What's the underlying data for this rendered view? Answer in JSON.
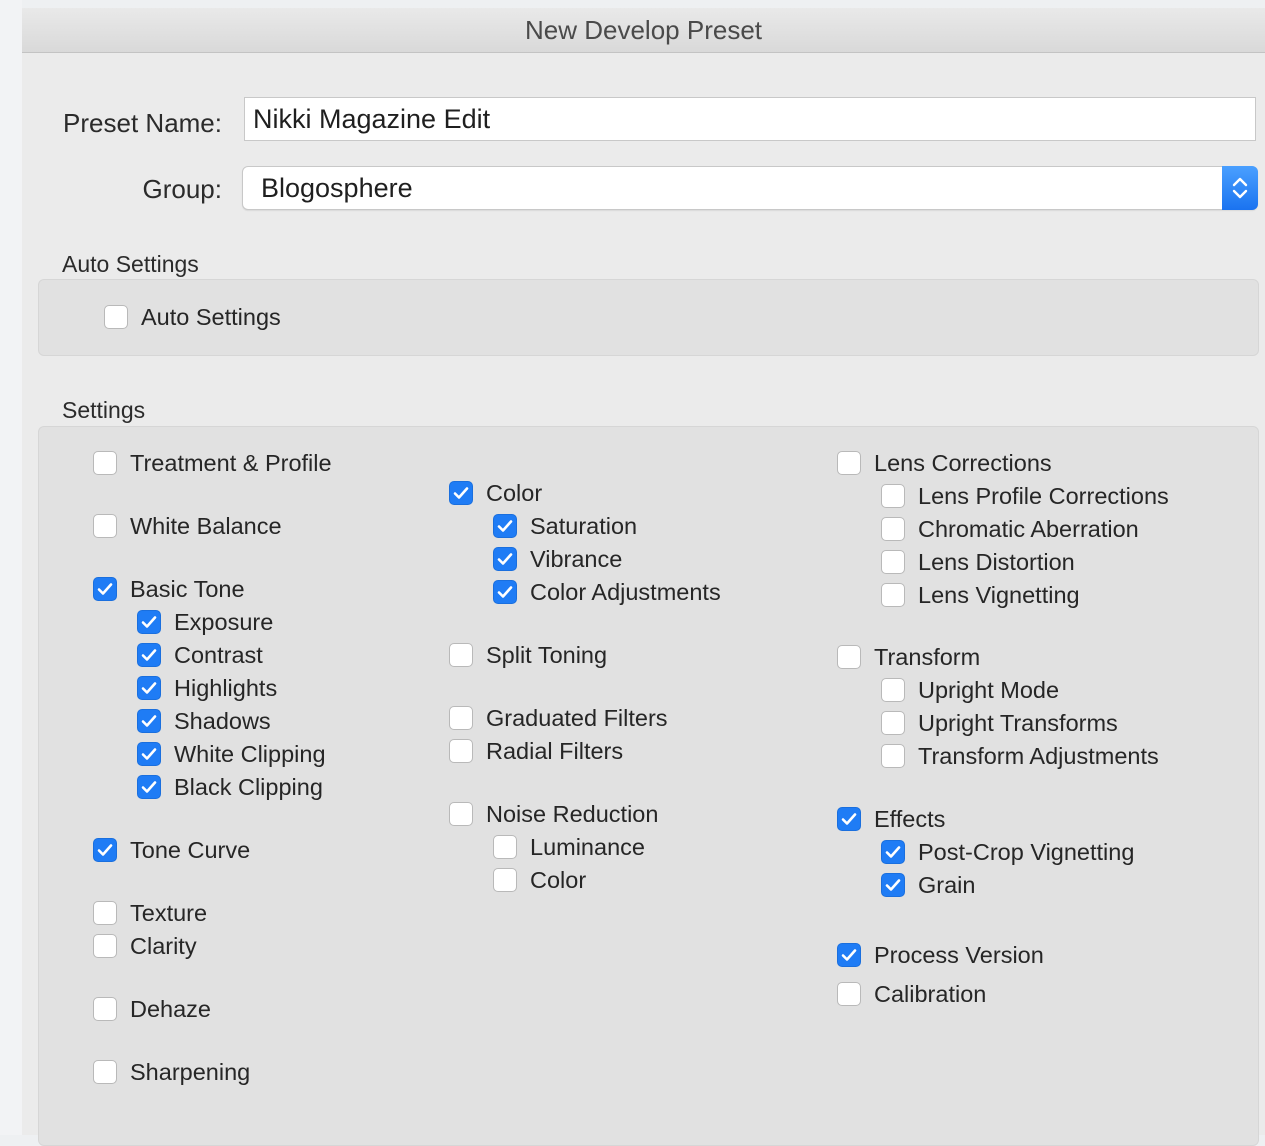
{
  "dialog": {
    "title": "New Develop Preset",
    "preset_name_label": "Preset Name:",
    "preset_name_value": "Nikki Magazine Edit",
    "group_label": "Group:",
    "group_value": "Blogosphere"
  },
  "auto_settings": {
    "section_title": "Auto Settings",
    "checkbox_label": "Auto Settings",
    "checked": false
  },
  "settings": {
    "section_title": "Settings",
    "col1": [
      {
        "label": "Treatment & Profile",
        "checked": false
      },
      {
        "label": "White Balance",
        "checked": false
      },
      {
        "label": "Basic Tone",
        "checked": true
      },
      {
        "label": "Exposure",
        "checked": true
      },
      {
        "label": "Contrast",
        "checked": true
      },
      {
        "label": "Highlights",
        "checked": true
      },
      {
        "label": "Shadows",
        "checked": true
      },
      {
        "label": "White Clipping",
        "checked": true
      },
      {
        "label": "Black Clipping",
        "checked": true
      },
      {
        "label": "Tone Curve",
        "checked": true
      },
      {
        "label": "Texture",
        "checked": false
      },
      {
        "label": "Clarity",
        "checked": false
      },
      {
        "label": "Dehaze",
        "checked": false
      },
      {
        "label": "Sharpening",
        "checked": false
      }
    ],
    "col2": [
      {
        "label": "Color",
        "checked": true
      },
      {
        "label": "Saturation",
        "checked": true
      },
      {
        "label": "Vibrance",
        "checked": true
      },
      {
        "label": "Color Adjustments",
        "checked": true
      },
      {
        "label": "Split Toning",
        "checked": false
      },
      {
        "label": "Graduated Filters",
        "checked": false
      },
      {
        "label": "Radial Filters",
        "checked": false
      },
      {
        "label": "Noise Reduction",
        "checked": false
      },
      {
        "label": "Luminance",
        "checked": false
      },
      {
        "label": "Color",
        "checked": false
      }
    ],
    "col3": [
      {
        "label": "Lens Corrections",
        "checked": false
      },
      {
        "label": "Lens Profile Corrections",
        "checked": false
      },
      {
        "label": "Chromatic Aberration",
        "checked": false
      },
      {
        "label": "Lens Distortion",
        "checked": false
      },
      {
        "label": "Lens Vignetting",
        "checked": false
      },
      {
        "label": "Transform",
        "checked": false
      },
      {
        "label": "Upright Mode",
        "checked": false
      },
      {
        "label": "Upright Transforms",
        "checked": false
      },
      {
        "label": "Transform Adjustments",
        "checked": false
      },
      {
        "label": "Effects",
        "checked": true
      },
      {
        "label": "Post-Crop Vignetting",
        "checked": true
      },
      {
        "label": "Grain",
        "checked": true
      },
      {
        "label": "Process Version",
        "checked": true
      },
      {
        "label": "Calibration",
        "checked": false
      }
    ]
  },
  "colors": {
    "accent": "#1f7cf5",
    "dialog_bg": "#ebebeb",
    "panel_bg": "#e1e1e1"
  }
}
